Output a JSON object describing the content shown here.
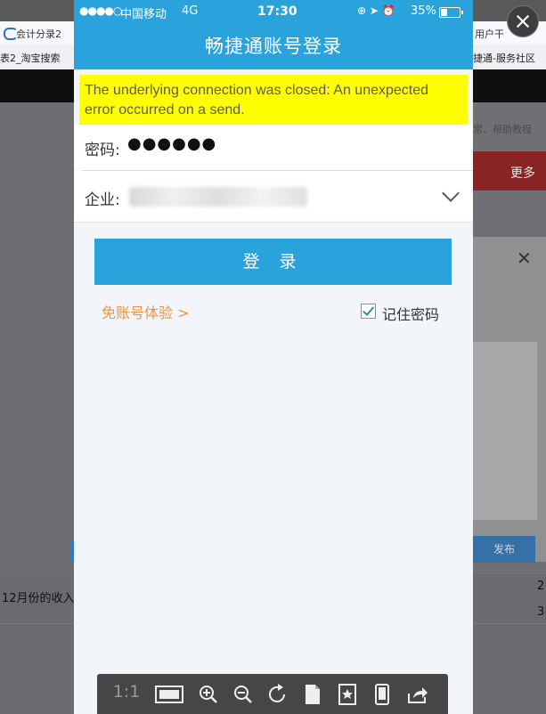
{
  "background": {
    "tab_left": "会计分录2",
    "tab_right": "用户干",
    "bookmark_left": "表2_淘宝搜索",
    "bookmark_right": "捷通-服务社区",
    "help_text": "常、帮助教程",
    "red_bar_text": "更多",
    "publish_button": "发布",
    "bottom_left_text": "12月份的收入",
    "num_2": "2",
    "num_3": "3"
  },
  "status_bar": {
    "signal": "●●●●○",
    "carrier": "中国移动",
    "network": "4G",
    "time": "17:30",
    "icons": "⊕ ➤ ⏰",
    "battery": "35%"
  },
  "header": {
    "title": "畅捷通账号登录"
  },
  "error": {
    "message": "The underlying connection was closed: An unexpected error occurred on a send."
  },
  "form": {
    "password_label": "密码:",
    "password_value": "●●●●●●",
    "company_label": "企业:",
    "login_button": "登 录",
    "trial_link": "免账号体验 >",
    "remember_label": "记住密码",
    "remember_checked": true
  },
  "toolbar": {
    "ratio_label": "1:1",
    "items": [
      "fit-screen-icon",
      "zoom-in-icon",
      "zoom-out-icon",
      "rotate-icon",
      "page-icon",
      "bookmark-star-icon",
      "device-icon",
      "share-icon"
    ]
  },
  "colors": {
    "header": "#2aa3dc",
    "error_bg": "#ffff00",
    "trial_link": "#f0933c"
  }
}
